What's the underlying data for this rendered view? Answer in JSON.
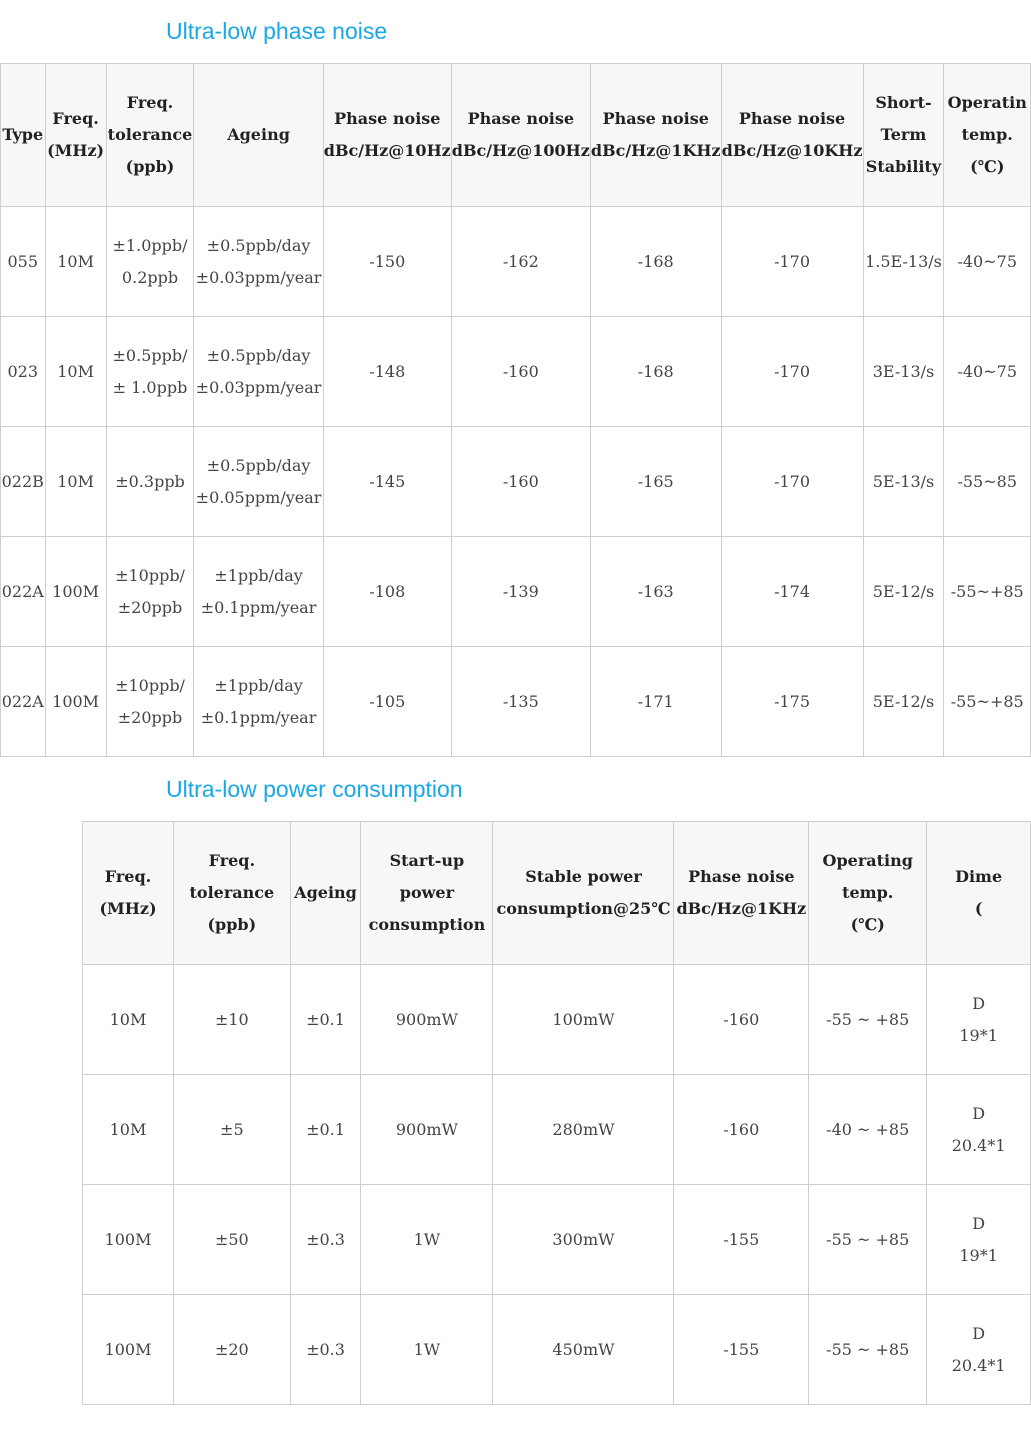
{
  "section1": {
    "title": "Ultra-low phase noise",
    "headers": [
      [
        "Type"
      ],
      [
        "Freq.",
        "(MHz)"
      ],
      [
        "Freq.",
        "tolerance",
        "(ppb)"
      ],
      [
        "Ageing"
      ],
      [
        "Phase noise",
        "dBc/Hz@10Hz"
      ],
      [
        "Phase noise",
        "dBc/Hz@100Hz"
      ],
      [
        "Phase noise",
        "dBc/Hz@1KHz"
      ],
      [
        "Phase noise",
        "dBc/Hz@10KHz"
      ],
      [
        "Short-",
        "Term",
        "Stability"
      ],
      [
        "Operatin",
        "temp.",
        "(℃)"
      ]
    ],
    "rows": [
      [
        [
          "055"
        ],
        [
          "10M"
        ],
        [
          "±1.0ppb/",
          "0.2ppb"
        ],
        [
          "±0.5ppb/day",
          "±0.03ppm/year"
        ],
        [
          "-150"
        ],
        [
          "-162"
        ],
        [
          "-168"
        ],
        [
          "-170"
        ],
        [
          "1.5E-13/s"
        ],
        [
          "-40~75"
        ]
      ],
      [
        [
          "023"
        ],
        [
          "10M"
        ],
        [
          "±0.5ppb/",
          "± 1.0ppb"
        ],
        [
          "±0.5ppb/day",
          "±0.03ppm/year"
        ],
        [
          "-148"
        ],
        [
          "-160"
        ],
        [
          "-168"
        ],
        [
          "-170"
        ],
        [
          "3E-13/s"
        ],
        [
          "-40~75"
        ]
      ],
      [
        [
          "022B"
        ],
        [
          "10M"
        ],
        [
          "±0.3ppb"
        ],
        [
          "±0.5ppb/day",
          "±0.05ppm/year"
        ],
        [
          "-145"
        ],
        [
          "-160"
        ],
        [
          "-165"
        ],
        [
          "-170"
        ],
        [
          "5E-13/s"
        ],
        [
          "-55~85"
        ]
      ],
      [
        [
          "022A"
        ],
        [
          "100M"
        ],
        [
          "±10ppb/",
          "±20ppb"
        ],
        [
          "±1ppb/day",
          "±0.1ppm/year"
        ],
        [
          "-108"
        ],
        [
          "-139"
        ],
        [
          "-163"
        ],
        [
          "-174"
        ],
        [
          "5E-12/s"
        ],
        [
          "-55~+85"
        ]
      ],
      [
        [
          "022A"
        ],
        [
          "100M"
        ],
        [
          "±10ppb/",
          "±20ppb"
        ],
        [
          "±1ppb/day",
          "±0.1ppm/year"
        ],
        [
          "-105"
        ],
        [
          "-135"
        ],
        [
          "-171"
        ],
        [
          "-175"
        ],
        [
          "5E-12/s"
        ],
        [
          "-55~+85"
        ]
      ]
    ]
  },
  "section2": {
    "title": "Ultra-low power consumption",
    "headers": [
      [
        "Freq.",
        "(MHz)"
      ],
      [
        "Freq.",
        "tolerance",
        "(ppb)"
      ],
      [
        "Ageing"
      ],
      [
        "Start-up",
        "power",
        "consumption"
      ],
      [
        "Stable power",
        "consumption@25℃"
      ],
      [
        "Phase noise",
        "dBc/Hz@1KHz"
      ],
      [
        "Operating",
        "temp.",
        "(℃)"
      ],
      [
        "Dime",
        "("
      ]
    ],
    "rows": [
      [
        [
          "10M"
        ],
        [
          "±10"
        ],
        [
          "±0.1"
        ],
        [
          "900mW"
        ],
        [
          "100mW"
        ],
        [
          "-160"
        ],
        [
          "-55 ~ +85"
        ],
        [
          "D",
          "19*1"
        ]
      ],
      [
        [
          "10M"
        ],
        [
          "±5"
        ],
        [
          "±0.1"
        ],
        [
          "900mW"
        ],
        [
          "280mW"
        ],
        [
          "-160"
        ],
        [
          "-40 ~ +85"
        ],
        [
          "D",
          "20.4*1"
        ]
      ],
      [
        [
          "100M"
        ],
        [
          "±50"
        ],
        [
          "±0.3"
        ],
        [
          "1W"
        ],
        [
          "300mW"
        ],
        [
          "-155"
        ],
        [
          "-55 ~ +85"
        ],
        [
          "D",
          "19*1"
        ]
      ],
      [
        [
          "100M"
        ],
        [
          "±20"
        ],
        [
          "±0.3"
        ],
        [
          "1W"
        ],
        [
          "450mW"
        ],
        [
          "-155"
        ],
        [
          "-55 ~ +85"
        ],
        [
          "D",
          "20.4*1"
        ]
      ]
    ]
  }
}
